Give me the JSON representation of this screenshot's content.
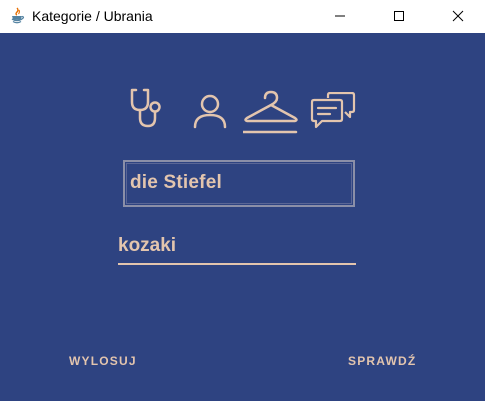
{
  "window": {
    "title": "Kategorie / Ubrania"
  },
  "icons": {
    "app": "java-icon",
    "minimize": "minimize-icon",
    "maximize": "maximize-icon",
    "close": "close-icon",
    "categories": [
      "stethoscope-icon",
      "person-icon",
      "hanger-icon",
      "chat-bubbles-icon"
    ]
  },
  "colors": {
    "background": "#2e4381",
    "accent": "#e3c5ae"
  },
  "main": {
    "word": "die Stiefel",
    "answer_value": "kozaki"
  },
  "buttons": {
    "draw_label": "WYLOSUJ",
    "check_label": "SPRAWDŹ"
  }
}
